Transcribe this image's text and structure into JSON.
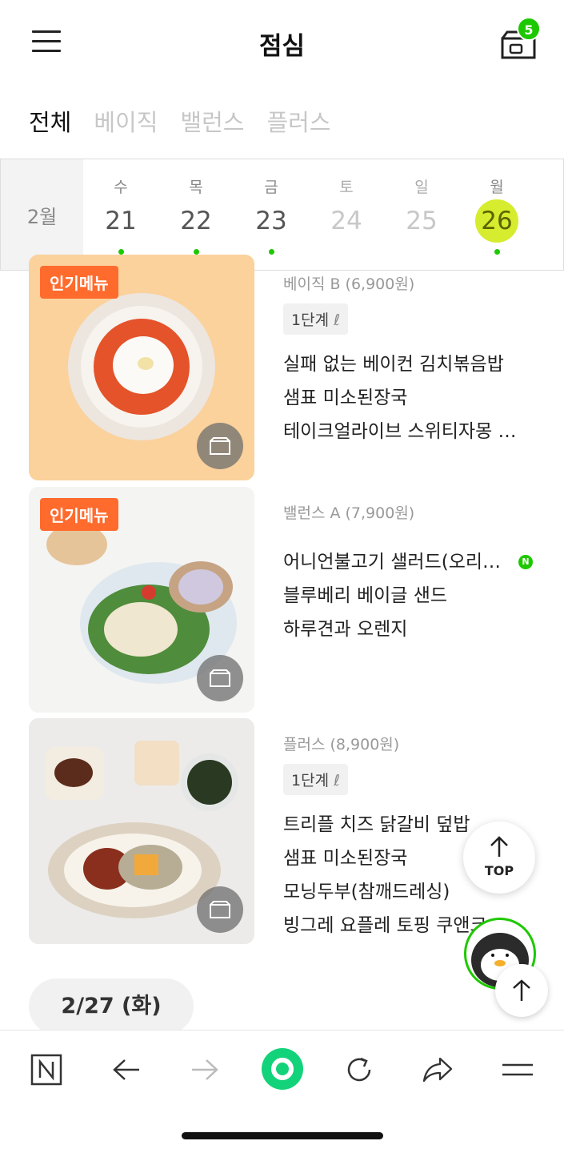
{
  "header": {
    "title": "점심",
    "cart_count": "5"
  },
  "tabs": [
    {
      "label": "전체",
      "active": true
    },
    {
      "label": "베이직"
    },
    {
      "label": "밸런스"
    },
    {
      "label": "플러스"
    }
  ],
  "date_strip": {
    "month": "2월",
    "days": [
      {
        "dow": "수",
        "num": "21",
        "dot": true
      },
      {
        "dow": "목",
        "num": "22",
        "dot": true
      },
      {
        "dow": "금",
        "num": "23",
        "dot": true
      },
      {
        "dow": "토",
        "num": "24",
        "muted": true
      },
      {
        "dow": "일",
        "num": "25",
        "muted": true
      },
      {
        "dow": "월",
        "num": "26",
        "dot": true,
        "selected": true
      }
    ]
  },
  "menus": [
    {
      "badge": "인기메뉴",
      "plan": "베이직 B (6,900원)",
      "level": "1단계",
      "items": [
        "실패 없는 베이컨 김치볶음밥",
        "샘표 미소된장국",
        "테이크얼라이브 스위티자몽 …"
      ]
    },
    {
      "badge": "인기메뉴",
      "plan": "밸런스 A (7,900원)",
      "items": [
        "어니언불고기 샐러드(오리…",
        "블루베리 베이글 샌드",
        "하루견과 오렌지"
      ],
      "naver_mark": "N"
    },
    {
      "plan": "플러스 (8,900원)",
      "level": "1단계",
      "items": [
        "트리플 치즈 닭갈비 덮밥",
        "샘표 미소된장국",
        "모닝두부(참깨드레싱)",
        "빙그레 요플레 토핑 쿠앤크"
      ]
    }
  ],
  "top_button": {
    "label": "TOP"
  },
  "next_date": {
    "label": "2/27 (화)"
  },
  "browser_bar": {
    "buttons": [
      "naver-home",
      "back",
      "forward",
      "green-dot",
      "reload",
      "share",
      "menu"
    ]
  },
  "colors": {
    "accent": "#1ec800",
    "popular": "#ff6b2d",
    "selected_day": "#d6ec2e"
  }
}
